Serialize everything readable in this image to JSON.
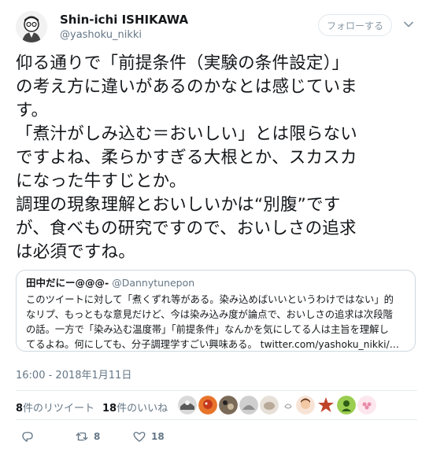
{
  "header": {
    "display_name": "Shin-ichi ISHIKAWA",
    "handle": "@yashoku_nikki",
    "follow_label": "フォローする"
  },
  "tweet": {
    "lines": [
      "仰る通りで「前提条件（実験の条件設定）」",
      "の考え方に違いがあるのかなとは感じていま",
      "す。",
      "「煮汁がしみ込む＝おいしい」とは限らない",
      "ですよね、柔らかすぎる大根とか、スカスカ",
      "になった牛すじとか。",
      "調理の現象理解とおいしいかは“別腹”です",
      "が、食べもの研究ですので、おいしさの追求",
      "は必須ですね。"
    ]
  },
  "quote": {
    "name": "田中だにー@@@-",
    "handle": "@Dannytunepon",
    "lines": [
      "このツイートに対して「煮くずれ等がある。染み込めばいいというわけではない」的",
      "なリプ、もっともな意見だけど、今は染み込み度が論点で、おいしさの追求は次段階",
      "の話。一方で「染み込む温度帯」「前提条件」なんかを気にしてる人は主旨を理解し",
      "てるよね。何にしても、分子調理学すごい興味ある。 twitter.com/yashoku_nikki/…"
    ]
  },
  "timestamp": "16:00 - 2018年1月11日",
  "stats": {
    "retweets_count": "8",
    "retweets_label": "件のリツイート",
    "likes_count": "18",
    "likes_label": "件のいいね"
  },
  "actions": {
    "retweet_count": "8",
    "like_count": "18"
  },
  "colors": {
    "link": "#1da1f2",
    "muted": "#657786",
    "border": "#e6ecf0"
  }
}
